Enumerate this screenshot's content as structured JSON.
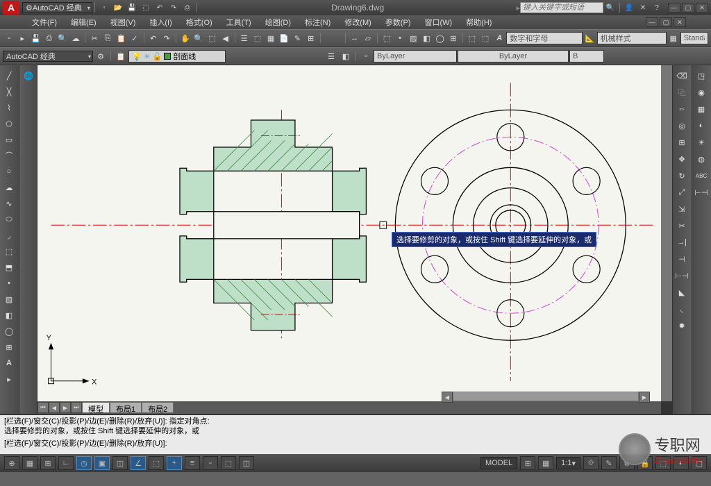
{
  "title": {
    "workspace": "AutoCAD 经典",
    "document": "Drawing6.dwg",
    "search_placeholder": "键入关键字或短语"
  },
  "menu": {
    "file": "文件(F)",
    "edit": "编辑(E)",
    "view": "视图(V)",
    "insert": "插入(I)",
    "format": "格式(O)",
    "tools": "工具(T)",
    "draw": "绘图(D)",
    "dimension": "标注(N)",
    "modify": "修改(M)",
    "params": "参数(P)",
    "window": "窗口(W)",
    "help": "帮助(H)"
  },
  "toolbar2": {
    "workspace": "AutoCAD 经典",
    "layer_name": "剖面线",
    "bylayer1": "ByLayer",
    "bylayer2": "ByLayer",
    "bylayer3": "B",
    "annotation": "数字和字母",
    "dimstyle": "机械样式",
    "textstyle": "Standa"
  },
  "canvas": {
    "ucs_x": "X",
    "ucs_y": "Y",
    "tooltip": "选择要修剪的对象，或按住 Shift 键选择要延伸的对象，或"
  },
  "tabs": {
    "model": "模型",
    "layout1": "布局1",
    "layout2": "布局2"
  },
  "cmd": {
    "line1": "[栏选(F)/窗交(C)/投影(P)/边(E)/删除(R)/放弃(U)]:   指定对角点:",
    "line2": "选择要修剪的对象，或按住 Shift 键选择要延伸的对象，或",
    "line3": "[栏选(F)/窗交(C)/投影(P)/边(E)/删除(R)/放弃(U)]:"
  },
  "status": {
    "scale": "1:1",
    "ann": "▲"
  },
  "watermark": {
    "name": "专职网",
    "url": "Zhuanzhi.Net"
  }
}
